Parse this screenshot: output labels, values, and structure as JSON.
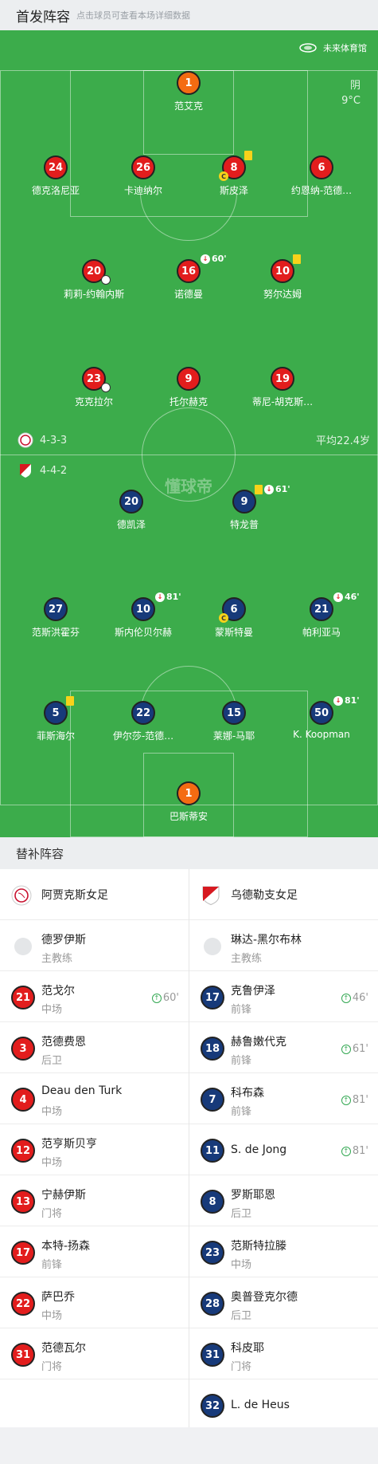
{
  "header": {
    "title": "首发阵容",
    "subtitle": "点击球员可查看本场详细数据"
  },
  "pitch": {
    "venue": "未来体育馆",
    "weather": "阴",
    "temperature": "9°C",
    "watermark": "懂球帝",
    "home_formation": "4-3-3",
    "away_formation": "4-4-2",
    "avg_age": "平均22.4岁"
  },
  "home_lineup": [
    {
      "num": "1",
      "name": "范艾克",
      "gk": true
    },
    {
      "num": "24",
      "name": "德克洛尼亚"
    },
    {
      "num": "26",
      "name": "卡迪纳尔"
    },
    {
      "num": "8",
      "name": "斯皮泽",
      "yellow": true,
      "captain": true
    },
    {
      "num": "6",
      "name": "约恩纳-范德…"
    },
    {
      "num": "20",
      "name": "莉莉-约翰内斯",
      "goal": true
    },
    {
      "num": "16",
      "name": "诺德曼",
      "sub_out": "60'"
    },
    {
      "num": "10",
      "name": "努尔达姆",
      "yellow": true
    },
    {
      "num": "23",
      "name": "克克拉尔",
      "goal": true
    },
    {
      "num": "9",
      "name": "托尔赫克"
    },
    {
      "num": "19",
      "name": "蒂尼-胡克斯…"
    }
  ],
  "away_lineup": [
    {
      "num": "20",
      "name": "德凯泽"
    },
    {
      "num": "9",
      "name": "特龙普",
      "yellow": true,
      "sub_out": "61'"
    },
    {
      "num": "27",
      "name": "范斯洪霍芬"
    },
    {
      "num": "10",
      "name": "斯内伦贝尔赫",
      "sub_out": "81'"
    },
    {
      "num": "6",
      "name": "蒙斯特曼",
      "captain": true
    },
    {
      "num": "21",
      "name": "帕利亚马",
      "sub_out": "46'"
    },
    {
      "num": "5",
      "name": "菲斯海尔",
      "yellow": true
    },
    {
      "num": "22",
      "name": "伊尔莎-范德…"
    },
    {
      "num": "15",
      "name": "莱娜-马耶"
    },
    {
      "num": "50",
      "name": "K. Koopman",
      "sub_out": "81'"
    },
    {
      "num": "1",
      "name": "巴斯蒂安",
      "gk": true
    }
  ],
  "bench": {
    "title": "替补阵容",
    "home": {
      "team": "阿贾克斯女足",
      "coach": {
        "name": "德罗伊斯",
        "role": "主教练"
      },
      "players": [
        {
          "num": "21",
          "name": "范戈尔",
          "pos": "中场",
          "in": "60'"
        },
        {
          "num": "3",
          "name": "范德费恩",
          "pos": "后卫"
        },
        {
          "num": "4",
          "name": "Deau den Turk",
          "pos": "中场"
        },
        {
          "num": "12",
          "name": "范亨斯贝亨",
          "pos": "中场"
        },
        {
          "num": "13",
          "name": "宁赫伊斯",
          "pos": "门将"
        },
        {
          "num": "17",
          "name": "本特-扬森",
          "pos": "前锋"
        },
        {
          "num": "22",
          "name": "萨巴乔",
          "pos": "中场"
        },
        {
          "num": "31",
          "name": "范德瓦尔",
          "pos": "门将"
        }
      ]
    },
    "away": {
      "team": "乌德勒支女足",
      "coach": {
        "name": "琳达-黑尔布林",
        "role": "主教练"
      },
      "players": [
        {
          "num": "17",
          "name": "克鲁伊泽",
          "pos": "前锋",
          "in": "46'"
        },
        {
          "num": "18",
          "name": "赫鲁嫩代克",
          "pos": "前锋",
          "in": "61'"
        },
        {
          "num": "7",
          "name": "科布森",
          "pos": "前锋",
          "in": "81'"
        },
        {
          "num": "11",
          "name": "S. de Jong",
          "pos": "",
          "in": "81'"
        },
        {
          "num": "8",
          "name": "罗斯耶恩",
          "pos": "后卫"
        },
        {
          "num": "23",
          "name": "范斯特拉滕",
          "pos": "中场"
        },
        {
          "num": "28",
          "name": "奥普登克尔德",
          "pos": "后卫"
        },
        {
          "num": "31",
          "name": "科皮耶",
          "pos": "门将"
        },
        {
          "num": "32",
          "name": "L. de Heus",
          "pos": ""
        }
      ]
    }
  },
  "colors": {
    "pitch": "#3cac4b",
    "home": "#e21d1d",
    "away": "#173a7a",
    "keeper": "#f46b12",
    "yellow_card": "#f7d21a",
    "sub_in": "#33a852"
  }
}
